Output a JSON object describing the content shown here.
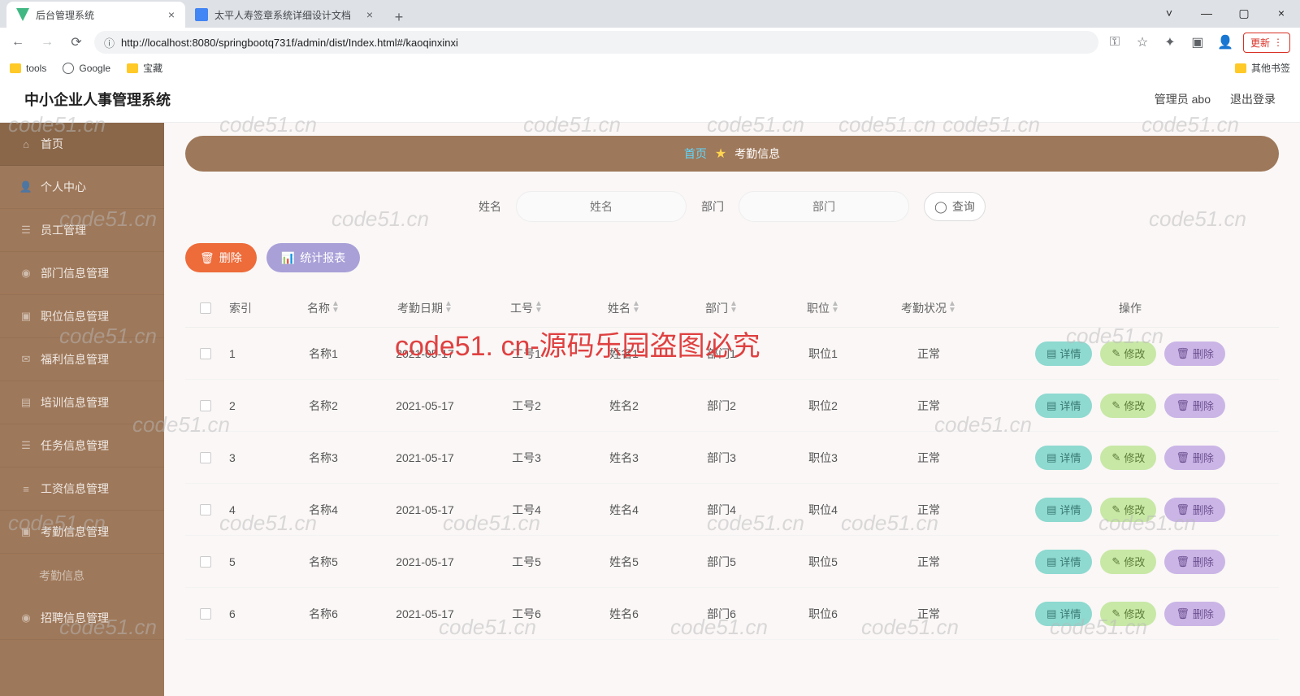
{
  "browser": {
    "tabs": [
      {
        "title": "后台管理系统"
      },
      {
        "title": "太平人寿签章系统详细设计文档"
      }
    ],
    "url": "http://localhost:8080/springbootq731f/admin/dist/Index.html#/kaoqinxinxi",
    "update_label": "更新",
    "bookmarks": {
      "tools": "tools",
      "google": "Google",
      "baozang": "宝藏",
      "other": "其他书签"
    }
  },
  "app": {
    "title": "中小企业人事管理系统",
    "user_prefix": "管理员 abo",
    "logout": "退出登录"
  },
  "sidebar": {
    "items": [
      "首页",
      "个人中心",
      "员工管理",
      "部门信息管理",
      "职位信息管理",
      "福利信息管理",
      "培训信息管理",
      "任务信息管理",
      "工资信息管理",
      "考勤信息管理",
      "招聘信息管理"
    ],
    "sub_active": "考勤信息"
  },
  "breadcrumb": {
    "home": "首页",
    "current": "考勤信息"
  },
  "search": {
    "name_label": "姓名",
    "name_ph": "姓名",
    "dept_label": "部门",
    "dept_ph": "部门",
    "btn": "查询"
  },
  "actions": {
    "delete": "删除",
    "stats": "统计报表"
  },
  "table": {
    "headers": [
      "索引",
      "名称",
      "考勤日期",
      "工号",
      "姓名",
      "部门",
      "职位",
      "考勤状况",
      "操作"
    ],
    "ops": {
      "detail": "详情",
      "edit": "修改",
      "delete": "删除"
    },
    "rows": [
      {
        "idx": "1",
        "name": "名称1",
        "date": "2021-05-17",
        "gh": "工号1",
        "xm": "姓名1",
        "bm": "部门1",
        "zw": "职位1",
        "zt": "正常"
      },
      {
        "idx": "2",
        "name": "名称2",
        "date": "2021-05-17",
        "gh": "工号2",
        "xm": "姓名2",
        "bm": "部门2",
        "zw": "职位2",
        "zt": "正常"
      },
      {
        "idx": "3",
        "name": "名称3",
        "date": "2021-05-17",
        "gh": "工号3",
        "xm": "姓名3",
        "bm": "部门3",
        "zw": "职位3",
        "zt": "正常"
      },
      {
        "idx": "4",
        "name": "名称4",
        "date": "2021-05-17",
        "gh": "工号4",
        "xm": "姓名4",
        "bm": "部门4",
        "zw": "职位4",
        "zt": "正常"
      },
      {
        "idx": "5",
        "name": "名称5",
        "date": "2021-05-17",
        "gh": "工号5",
        "xm": "姓名5",
        "bm": "部门5",
        "zw": "职位5",
        "zt": "正常"
      },
      {
        "idx": "6",
        "name": "名称6",
        "date": "2021-05-17",
        "gh": "工号6",
        "xm": "姓名6",
        "bm": "部门6",
        "zw": "职位6",
        "zt": "正常"
      }
    ]
  },
  "watermark": {
    "text": "code51.cn",
    "big": "code51. cn-源码乐园盗图必究"
  }
}
